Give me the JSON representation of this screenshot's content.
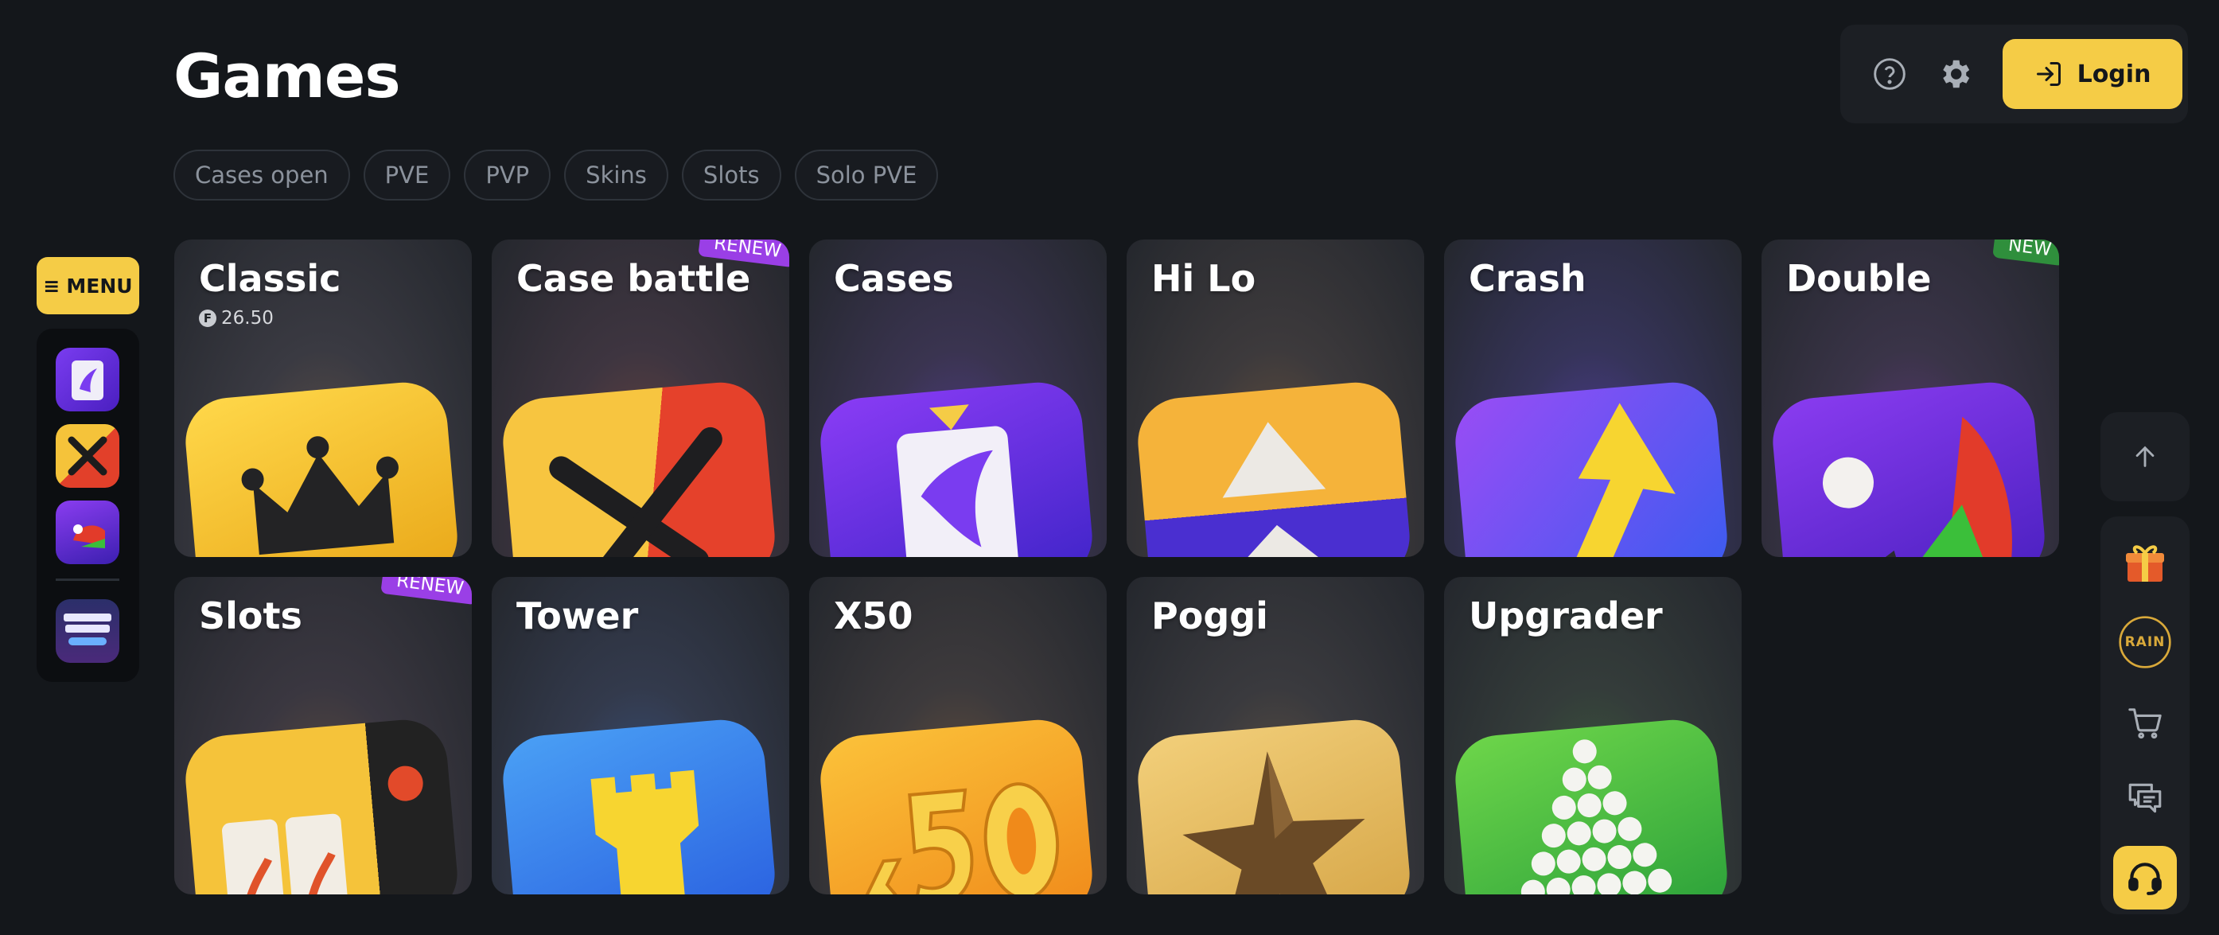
{
  "header": {
    "title": "Games"
  },
  "filters": [
    "Cases open",
    "PVE",
    "PVP",
    "Skins",
    "Slots",
    "Solo PVE"
  ],
  "topbar": {
    "login_label": "Login",
    "help_icon": "question-circle-icon",
    "settings_icon": "gear-icon",
    "login_icon": "login-arrow-icon"
  },
  "menu": {
    "label": "MENU",
    "icon": "hamburger-icon"
  },
  "left_rail": [
    {
      "name": "cases-shortcut",
      "icon": "card-knife-icon"
    },
    {
      "name": "case-battle-shortcut",
      "icon": "crossed-swords-icon"
    },
    {
      "name": "double-shortcut",
      "icon": "wheel-icon"
    },
    {
      "name": "skins-baron-event",
      "icon": "skins-baron-event-logo"
    }
  ],
  "right_rail": [
    {
      "name": "scroll-up",
      "icon": "arrow-up-icon"
    },
    {
      "name": "gifts",
      "icon": "gift-icon"
    },
    {
      "name": "rain",
      "icon": "rain-icon",
      "label": "RAIN"
    },
    {
      "name": "cart",
      "icon": "cart-icon"
    },
    {
      "name": "chat",
      "icon": "chat-icon"
    },
    {
      "name": "support",
      "icon": "headset-icon"
    }
  ],
  "games": [
    {
      "name": "Classic",
      "sub": "26.50",
      "badge": "",
      "art": "crown"
    },
    {
      "name": "Case battle",
      "badge": "RENEW",
      "art": "swords"
    },
    {
      "name": "Cases",
      "badge": "",
      "art": "card-knife"
    },
    {
      "name": "Hi Lo",
      "badge": "",
      "art": "triangles"
    },
    {
      "name": "Crash",
      "badge": "",
      "art": "arrow"
    },
    {
      "name": "Double",
      "badge": "NEW",
      "art": "wheel"
    },
    {
      "name": "Slots",
      "badge": "RENEW",
      "art": "slot-machine"
    },
    {
      "name": "Tower",
      "badge": "",
      "art": "tower"
    },
    {
      "name": "X50",
      "badge": "",
      "art": "x50"
    },
    {
      "name": "Poggi",
      "badge": "",
      "art": "star"
    },
    {
      "name": "Upgrader",
      "badge": "",
      "art": "pyramid"
    }
  ],
  "colors": {
    "background": "#14171b",
    "accent": "#f5cc46",
    "renew_badge": "#9a3fe6",
    "new_badge": "#2f8f3c"
  }
}
